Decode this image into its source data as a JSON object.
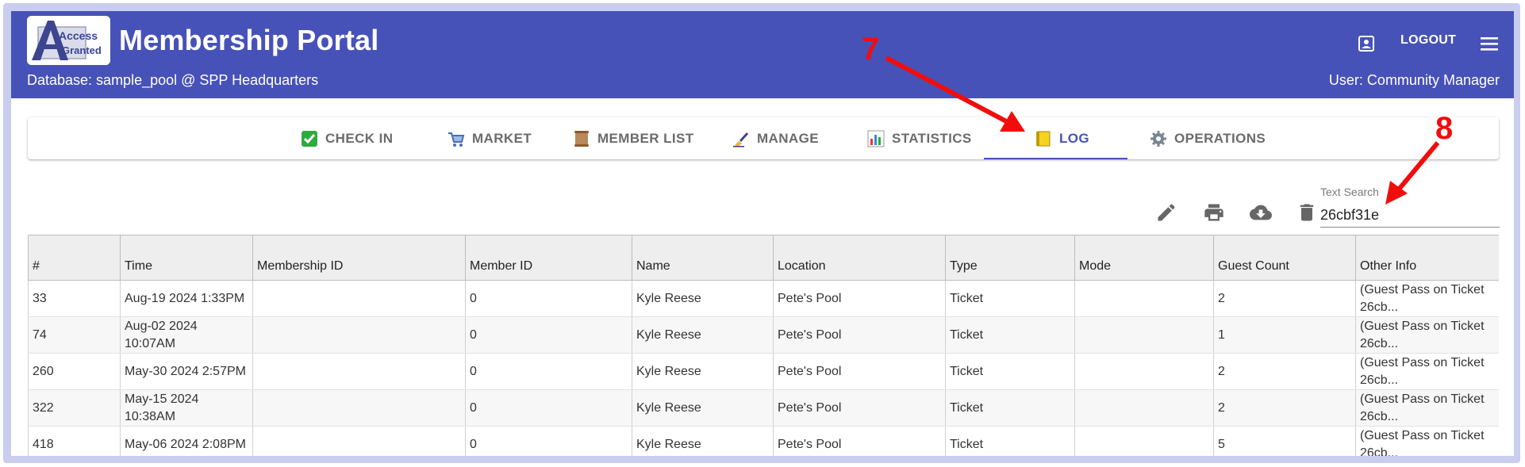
{
  "app": {
    "title": "Membership Portal",
    "logo_text_top": "Access",
    "logo_text_bottom": "Granted",
    "database": "Database: sample_pool @ SPP Headquarters",
    "user": "User: Community Manager",
    "logout_label": "LOGOUT",
    "colors": {
      "primary": "#4752b8",
      "annotation": "#f20d0d"
    }
  },
  "tabs": [
    {
      "label": "CHECK IN",
      "icon": "check-mark-icon"
    },
    {
      "label": "MARKET",
      "icon": "shopping-cart-icon"
    },
    {
      "label": "MEMBER LIST",
      "icon": "scroll-icon"
    },
    {
      "label": "MANAGE",
      "icon": "writing-hand-icon"
    },
    {
      "label": "STATISTICS",
      "icon": "bar-chart-icon"
    },
    {
      "label": "LOG",
      "icon": "ledger-icon",
      "active": true
    },
    {
      "label": "OPERATIONS",
      "icon": "gear-icon"
    }
  ],
  "toolbar": {
    "icons": [
      "edit-icon",
      "print-icon",
      "cloud-download-icon",
      "delete-icon"
    ]
  },
  "search": {
    "label": "Text Search",
    "value": "26cbf31e"
  },
  "table": {
    "columns": [
      "#",
      "Time",
      "Membership ID",
      "Member ID",
      "Name",
      "Location",
      "Type",
      "Mode",
      "Guest Count",
      "Other Info"
    ],
    "rows": [
      [
        "33",
        "Aug-19 2024 1:33PM",
        "",
        "0",
        "Kyle Reese",
        "Pete's Pool",
        "Ticket",
        "",
        "2",
        "(Guest Pass on Ticket 26cb..."
      ],
      [
        "74",
        "Aug-02 2024 10:07AM",
        "",
        "0",
        "Kyle Reese",
        "Pete's Pool",
        "Ticket",
        "",
        "1",
        "(Guest Pass on Ticket 26cb..."
      ],
      [
        "260",
        "May-30 2024 2:57PM",
        "",
        "0",
        "Kyle Reese",
        "Pete's Pool",
        "Ticket",
        "",
        "2",
        "(Guest Pass on Ticket 26cb..."
      ],
      [
        "322",
        "May-15 2024 10:38AM",
        "",
        "0",
        "Kyle Reese",
        "Pete's Pool",
        "Ticket",
        "",
        "2",
        "(Guest Pass on Ticket 26cb..."
      ],
      [
        "418",
        "May-06 2024 2:08PM",
        "",
        "0",
        "Kyle Reese",
        "Pete's Pool",
        "Ticket",
        "",
        "5",
        "(Guest Pass on Ticket 26cb..."
      ]
    ]
  },
  "annotations": [
    "7",
    "8"
  ]
}
